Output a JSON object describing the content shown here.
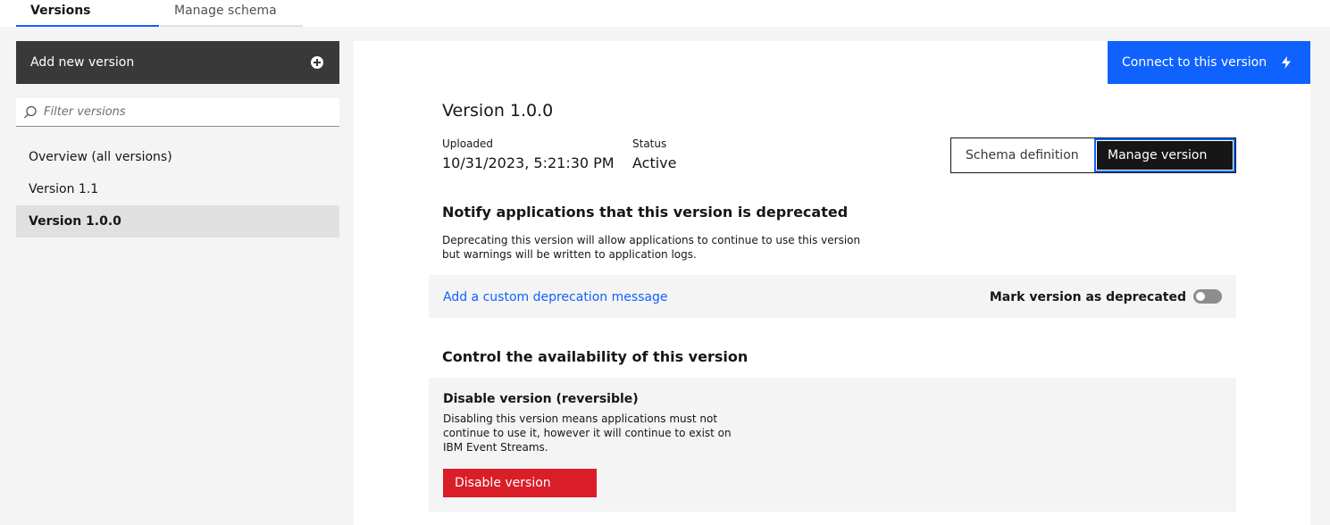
{
  "tabs": [
    {
      "label": "Versions",
      "active": true
    },
    {
      "label": "Manage schema",
      "active": false
    }
  ],
  "sidebar": {
    "add_button_label": "Add new version",
    "add_icon": "add-filled-icon",
    "filter_placeholder": "Filter versions",
    "filter_value": "",
    "items": [
      {
        "label": "Overview (all versions)",
        "selected": false
      },
      {
        "label": "Version 1.1",
        "selected": false
      },
      {
        "label": "Version 1.0.0",
        "selected": true
      }
    ]
  },
  "main": {
    "connect_button_label": "Connect to this version",
    "connect_icon": "lightning-icon",
    "version_title": "Version 1.0.0",
    "uploaded_label": "Uploaded",
    "uploaded_value": "10/31/2023, 5:21:30 PM",
    "status_label": "Status",
    "status_value": "Active",
    "segments": [
      "Schema definition",
      "Manage version"
    ],
    "selected_segment": "Manage version",
    "deprecate": {
      "heading": "Notify applications that this version is deprecated",
      "description": "Deprecating this version will allow applications to continue to use this version but warnings will be written to application logs.",
      "custom_message_link": "Add a custom deprecation message",
      "toggle_label": "Mark version as deprecated",
      "toggle_on": false
    },
    "availability": {
      "heading": "Control the availability of this version",
      "box_title": "Disable version (reversible)",
      "box_description": "Disabling this version means applications must not continue to use it, however it will continue to exist on IBM Event Streams.",
      "button_label": "Disable version"
    }
  },
  "colors": {
    "primary": "#0f62fe",
    "danger": "#da1e28",
    "dark": "#393939",
    "selected_bg": "#e0e0e0"
  }
}
